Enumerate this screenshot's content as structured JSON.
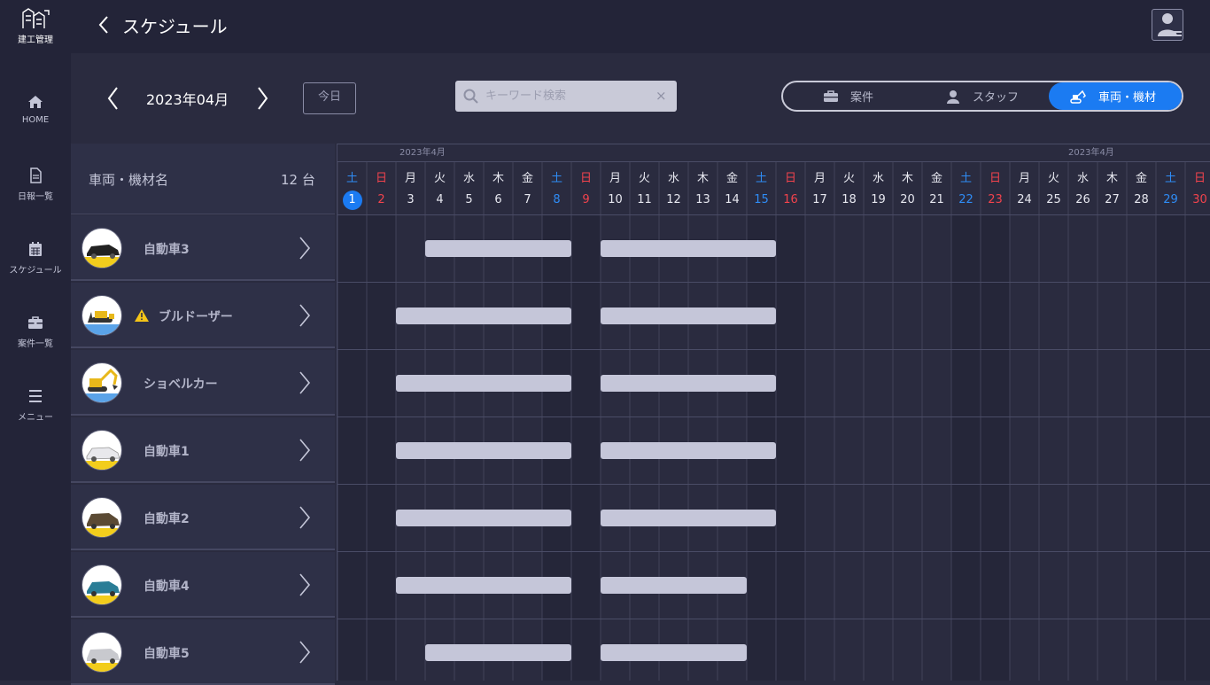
{
  "app": {
    "logo_text": "建工管理",
    "title": "スケジュール"
  },
  "sidebar": {
    "items": [
      {
        "label": "HOME",
        "icon": "home-icon"
      },
      {
        "label": "日報一覧",
        "icon": "document-icon"
      },
      {
        "label": "スケジュール",
        "icon": "calendar-icon"
      },
      {
        "label": "案件一覧",
        "icon": "briefcase-icon"
      },
      {
        "label": "メニュー",
        "icon": "menu-icon"
      }
    ]
  },
  "toolbar": {
    "month": "2023年04月",
    "today_label": "今日",
    "search_placeholder": "キーワード検索",
    "clear_label": "×"
  },
  "segments": [
    {
      "label": "案件",
      "icon": "briefcase-icon",
      "active": false
    },
    {
      "label": "スタッフ",
      "icon": "person-icon",
      "active": false
    },
    {
      "label": "車両・機材",
      "icon": "excavator-icon",
      "active": true
    }
  ],
  "list": {
    "title": "車両・機材名",
    "count": "12 台"
  },
  "calendar": {
    "month_labels": [
      "2023年4月",
      "2023年4月"
    ],
    "today": 1,
    "days": [
      {
        "dow": "土",
        "day": "1",
        "type": "sat"
      },
      {
        "dow": "日",
        "day": "2",
        "type": "sun"
      },
      {
        "dow": "月",
        "day": "3",
        "type": "wd"
      },
      {
        "dow": "火",
        "day": "4",
        "type": "wd"
      },
      {
        "dow": "水",
        "day": "5",
        "type": "wd"
      },
      {
        "dow": "木",
        "day": "6",
        "type": "wd"
      },
      {
        "dow": "金",
        "day": "7",
        "type": "wd"
      },
      {
        "dow": "土",
        "day": "8",
        "type": "sat"
      },
      {
        "dow": "日",
        "day": "9",
        "type": "sun"
      },
      {
        "dow": "月",
        "day": "10",
        "type": "wd"
      },
      {
        "dow": "火",
        "day": "11",
        "type": "wd"
      },
      {
        "dow": "水",
        "day": "12",
        "type": "wd"
      },
      {
        "dow": "木",
        "day": "13",
        "type": "wd"
      },
      {
        "dow": "金",
        "day": "14",
        "type": "wd"
      },
      {
        "dow": "土",
        "day": "15",
        "type": "sat"
      },
      {
        "dow": "日",
        "day": "16",
        "type": "sun"
      },
      {
        "dow": "月",
        "day": "17",
        "type": "wd"
      },
      {
        "dow": "火",
        "day": "18",
        "type": "wd"
      },
      {
        "dow": "水",
        "day": "19",
        "type": "wd"
      },
      {
        "dow": "木",
        "day": "20",
        "type": "wd"
      },
      {
        "dow": "金",
        "day": "21",
        "type": "wd"
      },
      {
        "dow": "土",
        "day": "22",
        "type": "sat"
      },
      {
        "dow": "日",
        "day": "23",
        "type": "sun"
      },
      {
        "dow": "月",
        "day": "24",
        "type": "wd"
      },
      {
        "dow": "火",
        "day": "25",
        "type": "wd"
      },
      {
        "dow": "水",
        "day": "26",
        "type": "wd"
      },
      {
        "dow": "木",
        "day": "27",
        "type": "wd"
      },
      {
        "dow": "金",
        "day": "28",
        "type": "wd"
      },
      {
        "dow": "土",
        "day": "29",
        "type": "sat"
      },
      {
        "dow": "日",
        "day": "30",
        "type": "sun"
      }
    ]
  },
  "vehicles": [
    {
      "name": "自動車3",
      "thumb": "sedan-black",
      "warning": false,
      "bookings": [
        [
          4,
          8
        ],
        [
          10,
          15
        ]
      ]
    },
    {
      "name": "ブルドーザー",
      "thumb": "bulldozer",
      "warning": true,
      "bookings": [
        [
          3,
          8
        ],
        [
          10,
          15
        ]
      ]
    },
    {
      "name": "ショベルカー",
      "thumb": "excavator",
      "warning": false,
      "bookings": [
        [
          3,
          8
        ],
        [
          10,
          15
        ]
      ]
    },
    {
      "name": "自動車1",
      "thumb": "sedan-white",
      "warning": false,
      "bookings": [
        [
          3,
          8
        ],
        [
          10,
          15
        ]
      ]
    },
    {
      "name": "自動車2",
      "thumb": "sedan-brown",
      "warning": false,
      "bookings": [
        [
          3,
          8
        ],
        [
          10,
          15
        ]
      ]
    },
    {
      "name": "自動車4",
      "thumb": "compact-teal",
      "warning": false,
      "bookings": [
        [
          3,
          8
        ],
        [
          10,
          14
        ]
      ]
    },
    {
      "name": "自動車5",
      "thumb": "wagon-silver",
      "warning": false,
      "bookings": [
        [
          4,
          8
        ],
        [
          10,
          14
        ]
      ]
    }
  ],
  "colors": {
    "accent": "#1b7bf2",
    "saturday": "#2f8cf5",
    "sunday": "#f2434d",
    "bar": "#c5c6d9",
    "background": "#2a2b3f"
  }
}
